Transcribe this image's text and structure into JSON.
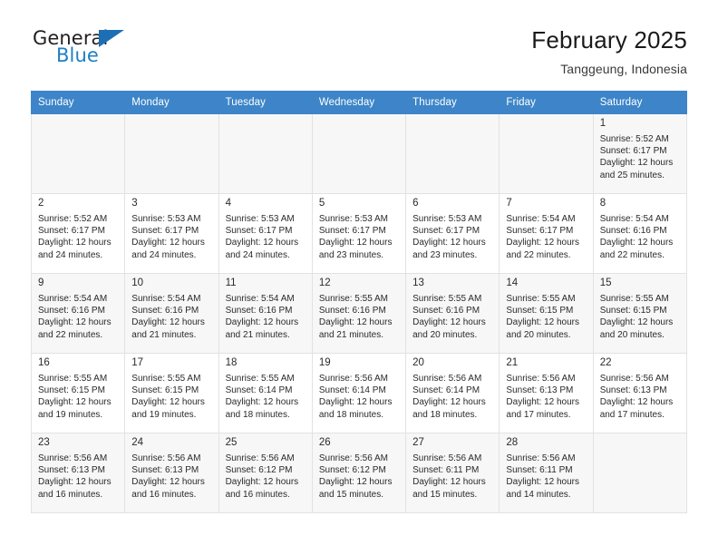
{
  "brand": {
    "name_part1": "General",
    "name_part2": "Blue",
    "triangle_color": "#1c6fb5",
    "blue_color": "#1f7fc4"
  },
  "header": {
    "title": "February 2025",
    "subtitle": "Tanggeung, Indonesia",
    "header_bg": "#3d85c8"
  },
  "weekday_headers": [
    "Sunday",
    "Monday",
    "Tuesday",
    "Wednesday",
    "Thursday",
    "Friday",
    "Saturday"
  ],
  "labels": {
    "sunrise": "Sunrise:",
    "sunset": "Sunset:",
    "daylight": "Daylight:"
  },
  "weeks": [
    [
      {
        "empty": true
      },
      {
        "empty": true
      },
      {
        "empty": true
      },
      {
        "empty": true
      },
      {
        "empty": true
      },
      {
        "empty": true
      },
      {
        "day": "1",
        "sunrise": "Sunrise: 5:52 AM",
        "sunset": "Sunset: 6:17 PM",
        "daylight": "Daylight: 12 hours and 25 minutes."
      }
    ],
    [
      {
        "day": "2",
        "sunrise": "Sunrise: 5:52 AM",
        "sunset": "Sunset: 6:17 PM",
        "daylight": "Daylight: 12 hours and 24 minutes."
      },
      {
        "day": "3",
        "sunrise": "Sunrise: 5:53 AM",
        "sunset": "Sunset: 6:17 PM",
        "daylight": "Daylight: 12 hours and 24 minutes."
      },
      {
        "day": "4",
        "sunrise": "Sunrise: 5:53 AM",
        "sunset": "Sunset: 6:17 PM",
        "daylight": "Daylight: 12 hours and 24 minutes."
      },
      {
        "day": "5",
        "sunrise": "Sunrise: 5:53 AM",
        "sunset": "Sunset: 6:17 PM",
        "daylight": "Daylight: 12 hours and 23 minutes."
      },
      {
        "day": "6",
        "sunrise": "Sunrise: 5:53 AM",
        "sunset": "Sunset: 6:17 PM",
        "daylight": "Daylight: 12 hours and 23 minutes."
      },
      {
        "day": "7",
        "sunrise": "Sunrise: 5:54 AM",
        "sunset": "Sunset: 6:17 PM",
        "daylight": "Daylight: 12 hours and 22 minutes."
      },
      {
        "day": "8",
        "sunrise": "Sunrise: 5:54 AM",
        "sunset": "Sunset: 6:16 PM",
        "daylight": "Daylight: 12 hours and 22 minutes."
      }
    ],
    [
      {
        "day": "9",
        "sunrise": "Sunrise: 5:54 AM",
        "sunset": "Sunset: 6:16 PM",
        "daylight": "Daylight: 12 hours and 22 minutes."
      },
      {
        "day": "10",
        "sunrise": "Sunrise: 5:54 AM",
        "sunset": "Sunset: 6:16 PM",
        "daylight": "Daylight: 12 hours and 21 minutes."
      },
      {
        "day": "11",
        "sunrise": "Sunrise: 5:54 AM",
        "sunset": "Sunset: 6:16 PM",
        "daylight": "Daylight: 12 hours and 21 minutes."
      },
      {
        "day": "12",
        "sunrise": "Sunrise: 5:55 AM",
        "sunset": "Sunset: 6:16 PM",
        "daylight": "Daylight: 12 hours and 21 minutes."
      },
      {
        "day": "13",
        "sunrise": "Sunrise: 5:55 AM",
        "sunset": "Sunset: 6:16 PM",
        "daylight": "Daylight: 12 hours and 20 minutes."
      },
      {
        "day": "14",
        "sunrise": "Sunrise: 5:55 AM",
        "sunset": "Sunset: 6:15 PM",
        "daylight": "Daylight: 12 hours and 20 minutes."
      },
      {
        "day": "15",
        "sunrise": "Sunrise: 5:55 AM",
        "sunset": "Sunset: 6:15 PM",
        "daylight": "Daylight: 12 hours and 20 minutes."
      }
    ],
    [
      {
        "day": "16",
        "sunrise": "Sunrise: 5:55 AM",
        "sunset": "Sunset: 6:15 PM",
        "daylight": "Daylight: 12 hours and 19 minutes."
      },
      {
        "day": "17",
        "sunrise": "Sunrise: 5:55 AM",
        "sunset": "Sunset: 6:15 PM",
        "daylight": "Daylight: 12 hours and 19 minutes."
      },
      {
        "day": "18",
        "sunrise": "Sunrise: 5:55 AM",
        "sunset": "Sunset: 6:14 PM",
        "daylight": "Daylight: 12 hours and 18 minutes."
      },
      {
        "day": "19",
        "sunrise": "Sunrise: 5:56 AM",
        "sunset": "Sunset: 6:14 PM",
        "daylight": "Daylight: 12 hours and 18 minutes."
      },
      {
        "day": "20",
        "sunrise": "Sunrise: 5:56 AM",
        "sunset": "Sunset: 6:14 PM",
        "daylight": "Daylight: 12 hours and 18 minutes."
      },
      {
        "day": "21",
        "sunrise": "Sunrise: 5:56 AM",
        "sunset": "Sunset: 6:13 PM",
        "daylight": "Daylight: 12 hours and 17 minutes."
      },
      {
        "day": "22",
        "sunrise": "Sunrise: 5:56 AM",
        "sunset": "Sunset: 6:13 PM",
        "daylight": "Daylight: 12 hours and 17 minutes."
      }
    ],
    [
      {
        "day": "23",
        "sunrise": "Sunrise: 5:56 AM",
        "sunset": "Sunset: 6:13 PM",
        "daylight": "Daylight: 12 hours and 16 minutes."
      },
      {
        "day": "24",
        "sunrise": "Sunrise: 5:56 AM",
        "sunset": "Sunset: 6:13 PM",
        "daylight": "Daylight: 12 hours and 16 minutes."
      },
      {
        "day": "25",
        "sunrise": "Sunrise: 5:56 AM",
        "sunset": "Sunset: 6:12 PM",
        "daylight": "Daylight: 12 hours and 16 minutes."
      },
      {
        "day": "26",
        "sunrise": "Sunrise: 5:56 AM",
        "sunset": "Sunset: 6:12 PM",
        "daylight": "Daylight: 12 hours and 15 minutes."
      },
      {
        "day": "27",
        "sunrise": "Sunrise: 5:56 AM",
        "sunset": "Sunset: 6:11 PM",
        "daylight": "Daylight: 12 hours and 15 minutes."
      },
      {
        "day": "28",
        "sunrise": "Sunrise: 5:56 AM",
        "sunset": "Sunset: 6:11 PM",
        "daylight": "Daylight: 12 hours and 14 minutes."
      },
      {
        "empty": true
      }
    ]
  ]
}
